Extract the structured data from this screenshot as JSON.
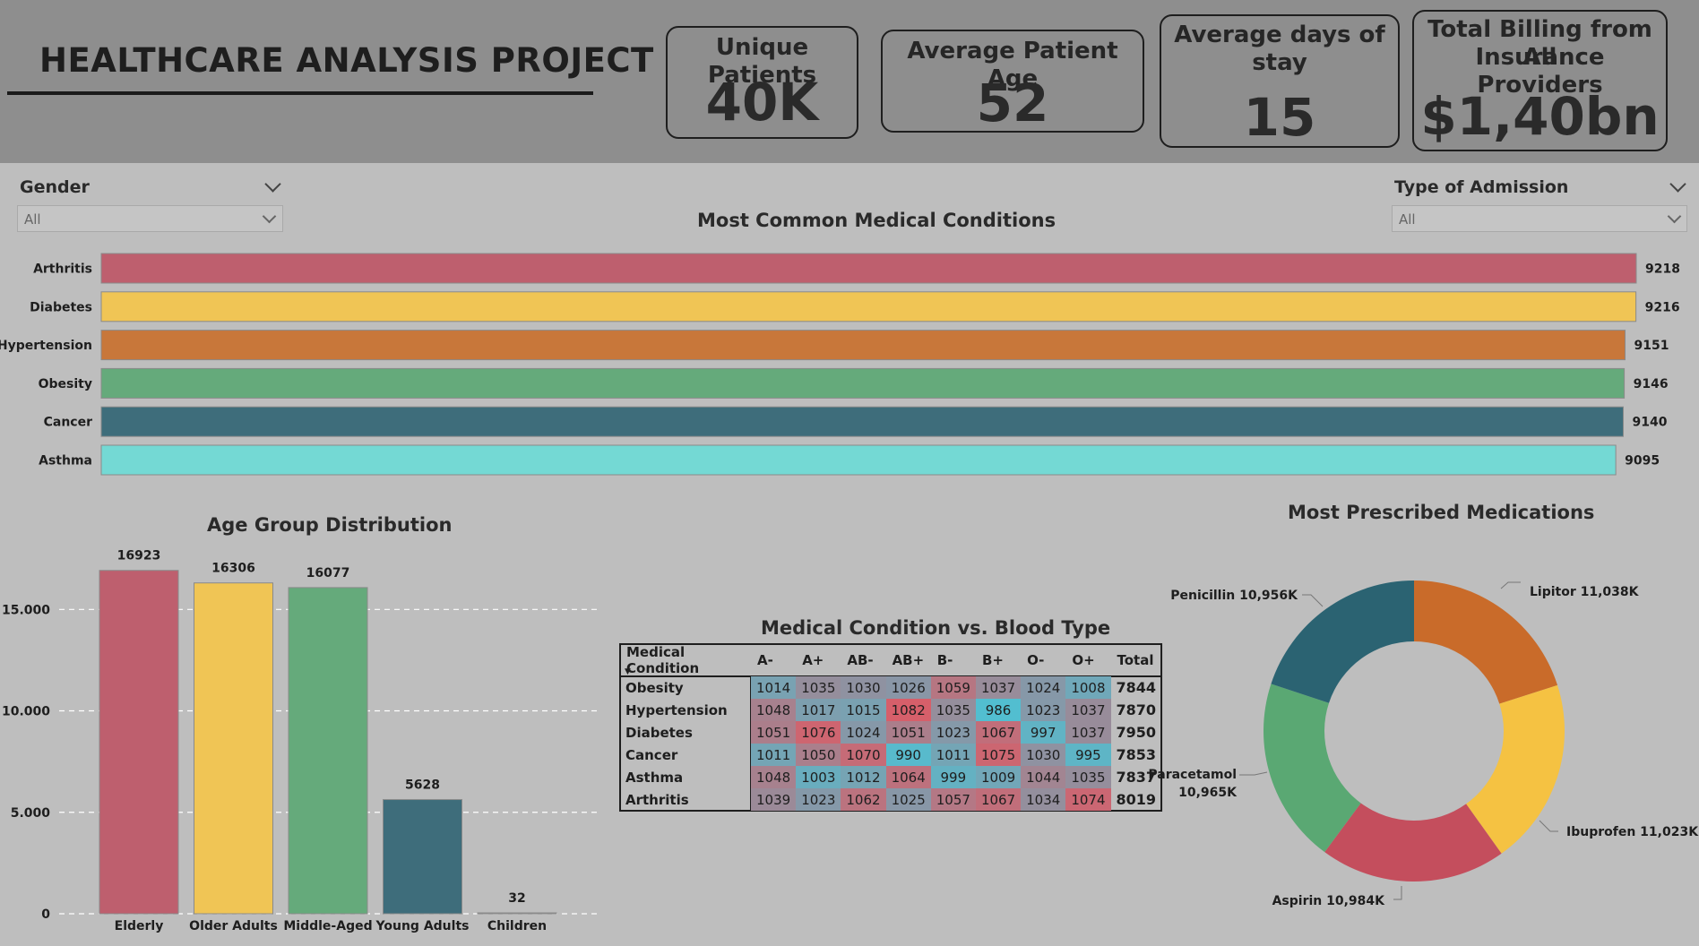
{
  "header": {
    "title": "HEALTHCARE ANALYSIS PROJECT",
    "kpis": [
      {
        "label_lines": [
          "Unique Patients"
        ],
        "value": "40K"
      },
      {
        "label_lines": [
          "Average Patient Age"
        ],
        "value": "52"
      },
      {
        "label_lines": [
          "Average days of",
          "stay"
        ],
        "value": "15"
      },
      {
        "label_lines": [
          "Total Billing from All",
          "Insurance Providers"
        ],
        "value": "$1,40bn"
      }
    ]
  },
  "filters": {
    "gender": {
      "label": "Gender",
      "value": "All"
    },
    "admission": {
      "label": "Type of Admission",
      "value": "All"
    }
  },
  "colors": {
    "red": "#be5f6e",
    "yellow": "#f0c555",
    "orange": "#c8773a",
    "green": "#65aa7b",
    "teal": "#3e6d7b",
    "cyan": "#74d9d4",
    "pie_teal": "#2b6372",
    "pie_orange": "#c96b2a",
    "pie_yellow": "#f5c242",
    "pie_red": "#c44e5d",
    "pie_green": "#5aa873"
  },
  "chart_data": [
    {
      "id": "conditions",
      "type": "bar",
      "orientation": "horizontal",
      "title": "Most Common Medical Conditions",
      "categories": [
        "Arthritis",
        "Diabetes",
        "Hypertension",
        "Obesity",
        "Cancer",
        "Asthma"
      ],
      "values": [
        9218,
        9216,
        9151,
        9146,
        9140,
        9095
      ],
      "colors": [
        "#be5f6e",
        "#f0c555",
        "#c8773a",
        "#65aa7b",
        "#3e6d7b",
        "#74d9d4"
      ]
    },
    {
      "id": "age_groups",
      "type": "bar",
      "title": "Age Group Distribution",
      "categories": [
        "Elderly",
        "Older Adults",
        "Middle-Aged",
        "Young Adults",
        "Children"
      ],
      "values": [
        16923,
        16306,
        16077,
        5628,
        32
      ],
      "colors": [
        "#be5f6e",
        "#f0c555",
        "#65aa7b",
        "#3e6d7b",
        "#3e6d7b"
      ],
      "yticks": [
        "0",
        "5.000",
        "10.000",
        "15.000"
      ],
      "ytick_values": [
        0,
        5000,
        10000,
        15000
      ],
      "ylim": [
        0,
        17500
      ],
      "grid": true
    },
    {
      "id": "blood_type",
      "type": "table",
      "title": "Medical Condition vs. Blood Type",
      "columns": [
        "Medical Condition",
        "A-",
        "A+",
        "AB-",
        "AB+",
        "B-",
        "B+",
        "O-",
        "O+",
        "Total"
      ],
      "rows": [
        {
          "label": "Obesity",
          "values": [
            1014,
            1035,
            1030,
            1026,
            1059,
            1037,
            1024,
            1008
          ],
          "total": 7844
        },
        {
          "label": "Hypertension",
          "values": [
            1048,
            1017,
            1015,
            1082,
            1035,
            986,
            1023,
            1037
          ],
          "total": 7870
        },
        {
          "label": "Diabetes",
          "values": [
            1051,
            1076,
            1024,
            1051,
            1023,
            1067,
            997,
            1037
          ],
          "total": 7950
        },
        {
          "label": "Cancer",
          "values": [
            1011,
            1050,
            1070,
            990,
            1011,
            1075,
            1030,
            995
          ],
          "total": 7853
        },
        {
          "label": "Asthma",
          "values": [
            1048,
            1003,
            1012,
            1064,
            999,
            1009,
            1044,
            1035
          ],
          "total": 7837
        },
        {
          "label": "Arthritis",
          "values": [
            1039,
            1023,
            1062,
            1025,
            1057,
            1067,
            1034,
            1074
          ],
          "total": 8019
        }
      ],
      "color_scale": {
        "low": "#52bed0",
        "high": "#d65f6a"
      }
    },
    {
      "id": "medications",
      "type": "pie",
      "donut": true,
      "title": "Most Prescribed Medications",
      "slices": [
        {
          "name": "Lipitor",
          "label": "Lipitor 11,038K",
          "value": 11038,
          "color": "#c96b2a"
        },
        {
          "name": "Ibuprofen",
          "label": "Ibuprofen 11,023K",
          "value": 11023,
          "color": "#f5c242"
        },
        {
          "name": "Aspirin",
          "label": "Aspirin 10,984K",
          "value": 10984,
          "color": "#c44e5d"
        },
        {
          "name": "Paracetamol",
          "label_lines": [
            "Paracetamol",
            "10,965K"
          ],
          "value": 10965,
          "color": "#5aa873"
        },
        {
          "name": "Penicillin",
          "label": "Penicillin 10,956K",
          "value": 10956,
          "color": "#2b6372"
        }
      ]
    }
  ]
}
